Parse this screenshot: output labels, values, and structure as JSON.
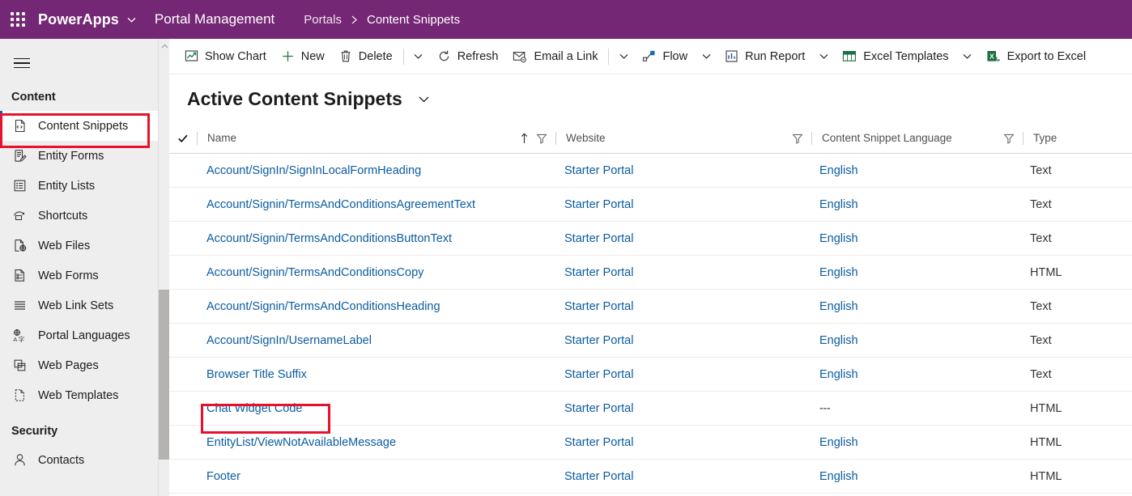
{
  "topbar": {
    "waffle_icon": "waffle-grid-icon",
    "brand": "PowerApps",
    "brand_chevron_icon": "chevron-down-icon",
    "app_name": "Portal Management",
    "breadcrumb": {
      "parent": "Portals",
      "separator": "›",
      "current": "Content Snippets"
    },
    "bg_color": "#742774"
  },
  "sidebar": {
    "hamburger_icon": "hamburger-menu-icon",
    "groups": [
      {
        "title": "Content",
        "items": [
          {
            "label": "Content Snippets",
            "icon": "code-file-icon",
            "selected": true
          },
          {
            "label": "Entity Forms",
            "icon": "form-edit-icon",
            "selected": false
          },
          {
            "label": "Entity Lists",
            "icon": "list-icon",
            "selected": false
          },
          {
            "label": "Shortcuts",
            "icon": "shortcut-arrow-icon",
            "selected": false
          },
          {
            "label": "Web Files",
            "icon": "file-globe-icon",
            "selected": false
          },
          {
            "label": "Web Forms",
            "icon": "web-form-icon",
            "selected": false
          },
          {
            "label": "Web Link Sets",
            "icon": "link-lines-icon",
            "selected": false
          },
          {
            "label": "Portal Languages",
            "icon": "language-icon",
            "selected": false
          },
          {
            "label": "Web Pages",
            "icon": "pages-icon",
            "selected": false
          },
          {
            "label": "Web Templates",
            "icon": "template-file-icon",
            "selected": false
          }
        ]
      },
      {
        "title": "Security",
        "items": [
          {
            "label": "Contacts",
            "icon": "person-icon",
            "selected": false
          }
        ]
      }
    ],
    "scroll_up_icon": "chevron-up-icon",
    "selection_accent": "#0d5ec2"
  },
  "commandbar": {
    "items": [
      {
        "label": "Show Chart",
        "icon": "chart-icon",
        "chevron": false,
        "sep_after": false
      },
      {
        "label": "New",
        "icon": "plus-icon",
        "chevron": false,
        "sep_after": false
      },
      {
        "label": "Delete",
        "icon": "trash-icon",
        "chevron": true,
        "sep_before": true
      },
      {
        "label": "Refresh",
        "icon": "refresh-icon",
        "chevron": false,
        "sep_after": false
      },
      {
        "label": "Email a Link",
        "icon": "email-link-icon",
        "chevron": true,
        "sep_before": true
      },
      {
        "label": "Flow",
        "icon": "flow-icon",
        "chevron": true,
        "sep_after": false
      },
      {
        "label": "Run Report",
        "icon": "report-icon",
        "chevron": true,
        "sep_after": false
      },
      {
        "label": "Excel Templates",
        "icon": "excel-template-icon",
        "chevron": true,
        "sep_after": false
      },
      {
        "label": "Export to Excel",
        "icon": "excel-export-icon",
        "chevron": false,
        "sep_after": false
      }
    ]
  },
  "view": {
    "title": "Active Content Snippets",
    "chevron_icon": "chevron-down-icon"
  },
  "grid": {
    "select_all_icon": "checkmark-icon",
    "columns": [
      {
        "label": "Name",
        "sort_icon": "sort-ascending-icon",
        "filter_icon": "filter-icon"
      },
      {
        "label": "Website",
        "sort_icon": "",
        "filter_icon": "filter-icon"
      },
      {
        "label": "Content Snippet Language",
        "sort_icon": "",
        "filter_icon": "filter-icon"
      },
      {
        "label": "Type",
        "sort_icon": "",
        "filter_icon": ""
      }
    ],
    "rows": [
      {
        "name": "Account/SignIn/SignInLocalFormHeading",
        "website": "Starter Portal",
        "language": "English",
        "type": "Text",
        "language_is_link": true,
        "highlight": false
      },
      {
        "name": "Account/Signin/TermsAndConditionsAgreementText",
        "website": "Starter Portal",
        "language": "English",
        "type": "Text",
        "language_is_link": true,
        "highlight": false
      },
      {
        "name": "Account/Signin/TermsAndConditionsButtonText",
        "website": "Starter Portal",
        "language": "English",
        "type": "Text",
        "language_is_link": true,
        "highlight": false
      },
      {
        "name": "Account/Signin/TermsAndConditionsCopy",
        "website": "Starter Portal",
        "language": "English",
        "type": "HTML",
        "language_is_link": true,
        "highlight": false
      },
      {
        "name": "Account/Signin/TermsAndConditionsHeading",
        "website": "Starter Portal",
        "language": "English",
        "type": "Text",
        "language_is_link": true,
        "highlight": false
      },
      {
        "name": "Account/SignIn/UsernameLabel",
        "website": "Starter Portal",
        "language": "English",
        "type": "Text",
        "language_is_link": true,
        "highlight": false
      },
      {
        "name": "Browser Title Suffix",
        "website": "Starter Portal",
        "language": "English",
        "type": "Text",
        "language_is_link": true,
        "highlight": false
      },
      {
        "name": "Chat Widget Code",
        "website": "Starter Portal",
        "language": "---",
        "type": "HTML",
        "language_is_link": false,
        "highlight": true
      },
      {
        "name": "EntityList/ViewNotAvailableMessage",
        "website": "Starter Portal",
        "language": "English",
        "type": "HTML",
        "language_is_link": true,
        "highlight": false
      },
      {
        "name": "Footer",
        "website": "Starter Portal",
        "language": "English",
        "type": "HTML",
        "language_is_link": true,
        "highlight": false
      }
    ]
  },
  "annotations": {
    "box_color": "#e8112d",
    "targets": [
      "sidebar-item-content-snippets",
      "row-chat-widget-code"
    ]
  }
}
